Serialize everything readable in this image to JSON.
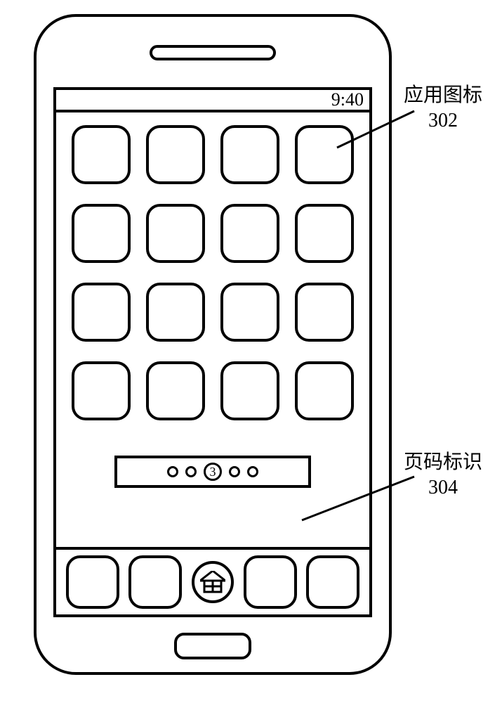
{
  "status": {
    "time": "9:40"
  },
  "pager": {
    "current_label": "3",
    "dots_before": 2,
    "dots_after": 2
  },
  "callouts": {
    "app_icon": {
      "label": "应用图标",
      "ref": "302"
    },
    "page_ind": {
      "label": "页码标识",
      "ref": "304"
    }
  },
  "grid": {
    "rows": 4,
    "cols": 4
  },
  "dock": {
    "icons": 4
  }
}
